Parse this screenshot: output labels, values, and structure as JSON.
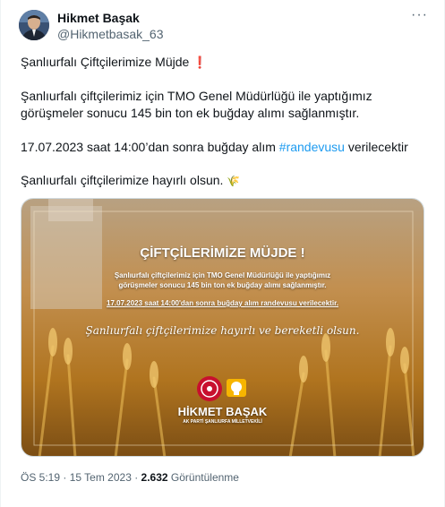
{
  "author": {
    "name": "Hikmet Başak",
    "handle": "@Hikmetbasak_63"
  },
  "more_label": "···",
  "post": {
    "line1": "Şanlıurfalı Çiftçilerimize Müjde",
    "line1_emoji": "❗",
    "p2_line1": "Şanlıurfalı çiftçilerimiz için TMO Genel Müdürlüğü ile yaptığımız",
    "p2_line2": "görüşmeler sonucu 145 bin ton ek buğday alımı sağlanmıştır.",
    "p3_before": "17.07.2023 saat 14:00’dan sonra buğday alım ",
    "p3_hashtag": "#randevusu",
    "p3_after": " verilecektir",
    "p4": "Şanlıurfalı çiftçilerimize hayırlı olsun.",
    "p4_emoji": "🌾"
  },
  "image": {
    "title": "ÇİFTÇİLERİMİZE MÜJDE !",
    "body_line1": "Şanlıurfalı çiftçilerimiz için TMO Genel Müdürlüğü ile yaptığımız",
    "body_line2": "görüşmeler sonucu 145 bin ton ek buğday alımı sağlanmıştır.",
    "date_line": "17.07.2023 saat 14:00'dan sonra buğday alım randevusu verilecektir.",
    "script_line": "Şanlıurfalı çiftçilerimize hayırlı ve bereketli olsun.",
    "sig_name": "HİKMET BAŞAK",
    "sig_title": "AK PARTİ ŞANLIURFA MİLLETVEKİLİ"
  },
  "footer": {
    "time": "ÖS 5:19",
    "sep1": " · ",
    "date": "15 Tem 2023",
    "sep2": " · ",
    "views": "2.632",
    "views_label": " Görüntülenme"
  },
  "colors": {
    "link": "#1d9bf0",
    "muted": "#536471",
    "text": "#0f1419"
  }
}
